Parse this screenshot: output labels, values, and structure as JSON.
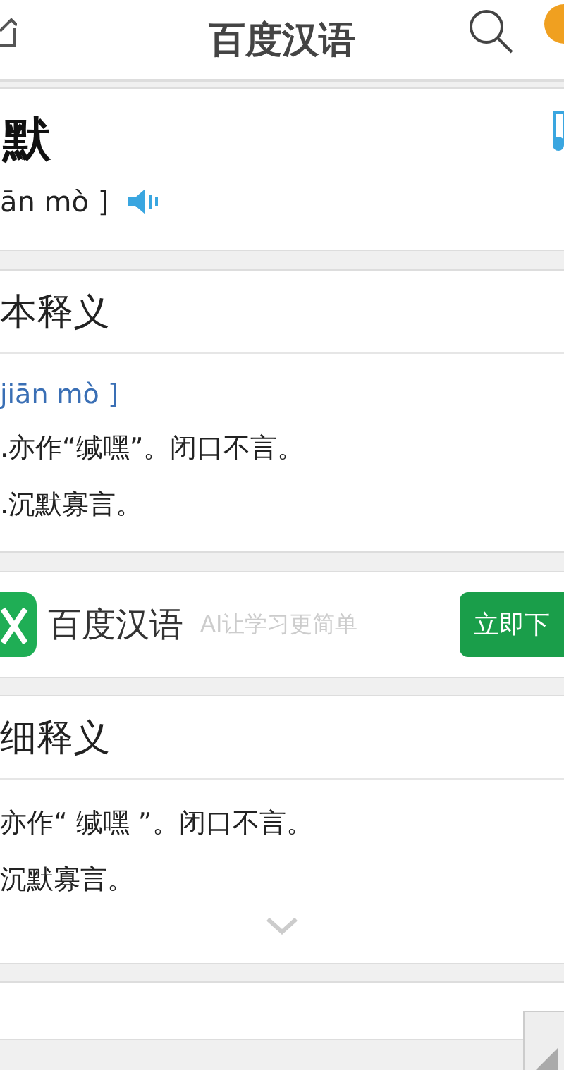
{
  "header": {
    "title": "百度汉语"
  },
  "word": {
    "text": "默",
    "pinyin": "ān mò ]"
  },
  "basic": {
    "heading": "本释义",
    "pinyin": "jiān mò ]",
    "items": [
      ".亦作“缄嘿”。闭口不言。",
      ".沉默寡言。"
    ]
  },
  "ad": {
    "app_name": "百度汉语",
    "slogan": "AI让学习更简单",
    "button": "立即下"
  },
  "detailed": {
    "heading": "细释义",
    "items": [
      "亦作“ 缄嘿 ”。闭口不言。",
      "沉默寡言。"
    ]
  }
}
